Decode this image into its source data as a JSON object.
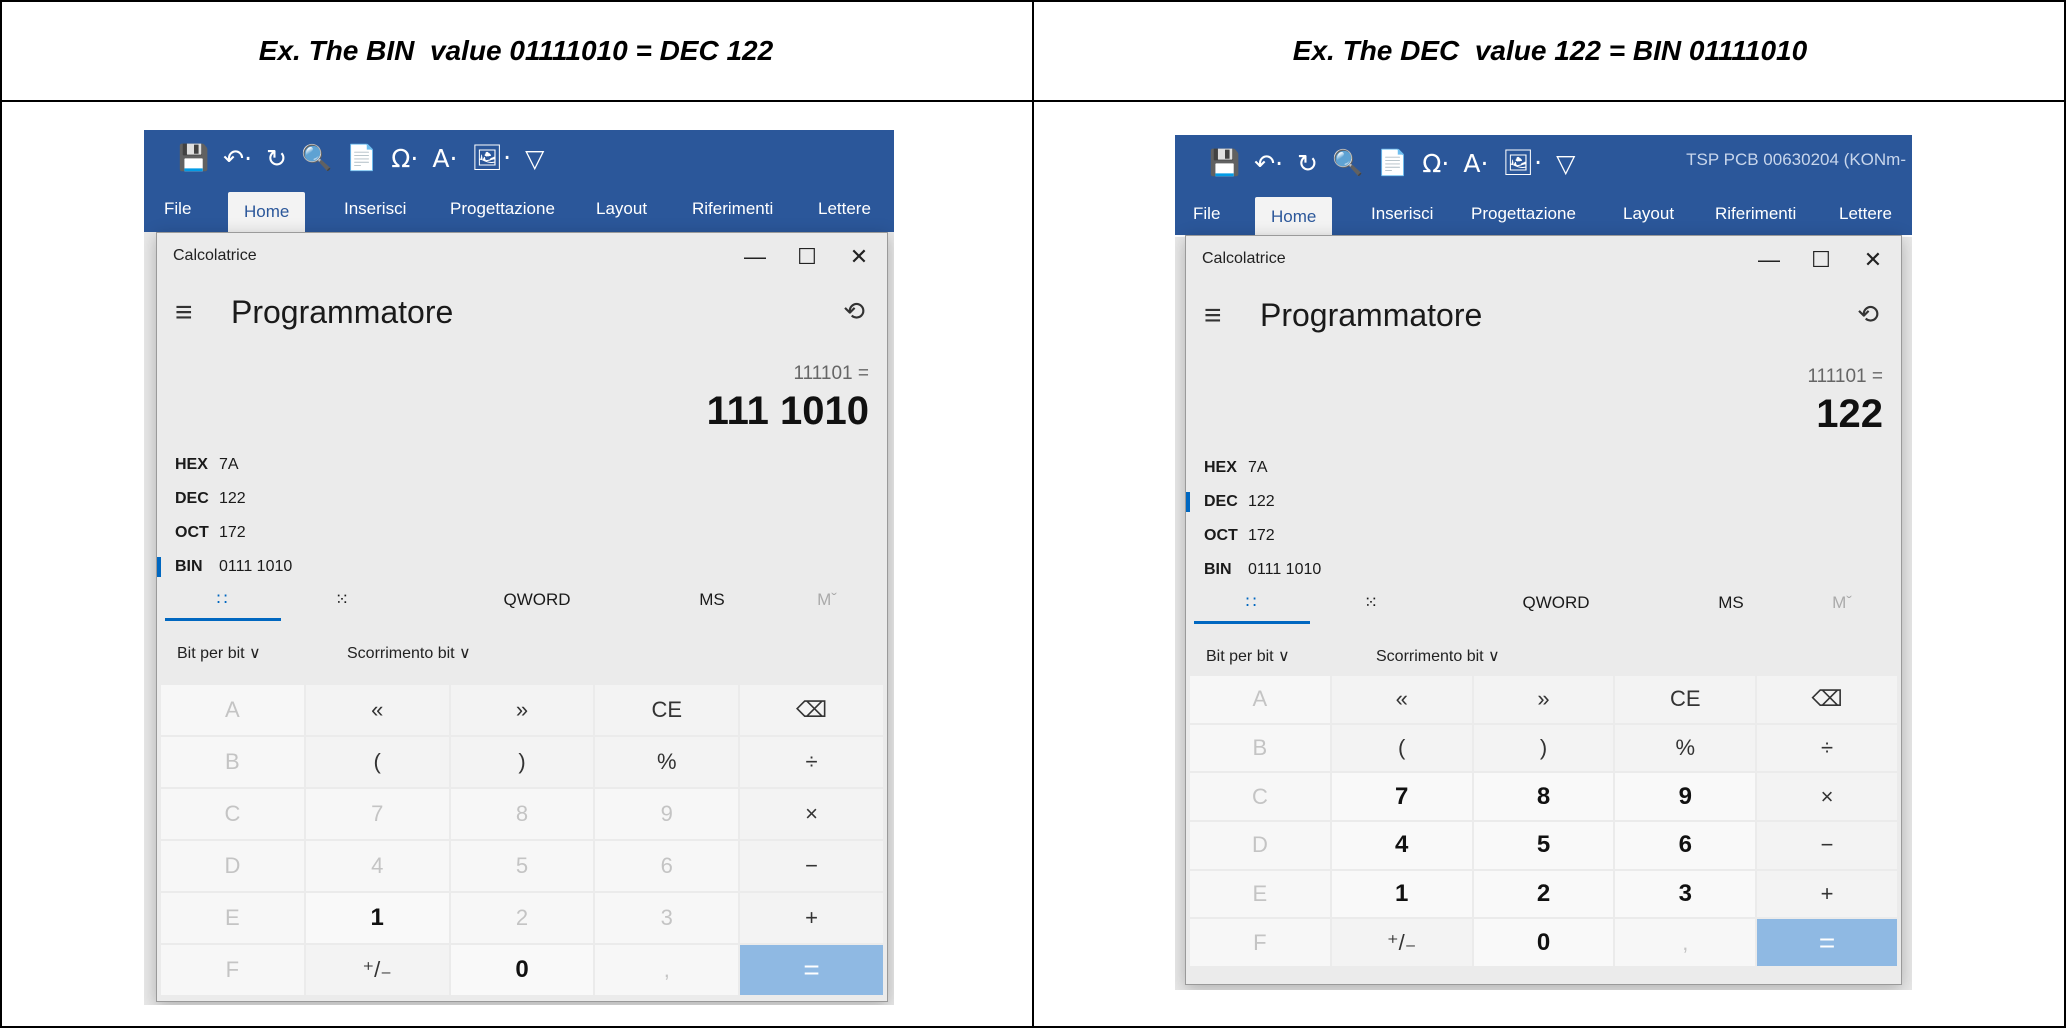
{
  "left": {
    "header": "Ex. The BIN  value 01111010 = DEC 122",
    "word": {
      "qat": [
        "💾",
        "↶·",
        "↻",
        "🔍",
        "📄",
        "Ω·",
        "A·",
        "🖼·",
        "▽"
      ],
      "doc_name": "",
      "tabs": [
        "File",
        "Home",
        "Inserisci",
        "Progettazione",
        "Layout",
        "Riferimenti",
        "Lettere"
      ]
    },
    "calc": {
      "app_name": "Calcolatrice",
      "minimize": "—",
      "maximize": "☐",
      "close": "✕",
      "hamburger": "≡",
      "mode": "Programmatore",
      "history_icon": "⟲",
      "expression": "111101 =",
      "result": "111 1010",
      "radix": [
        {
          "key": "HEX",
          "value": "7A"
        },
        {
          "key": "DEC",
          "value": "122"
        },
        {
          "key": "OCT",
          "value": "172"
        },
        {
          "key": "BIN",
          "value": "0111 1010"
        }
      ],
      "selected_radix": "BIN",
      "keypad_tabs": {
        "full": "∷",
        "bit": "⁙",
        "word": "QWORD",
        "ms": "MS",
        "m": "Mˇ"
      },
      "bitwise": "Bit per bit ∨",
      "bitshift": "Scorrimento bit ∨",
      "keys": [
        "A",
        "«",
        "»",
        "CE",
        "⌫",
        "B",
        "(",
        ")",
        "%",
        "÷",
        "C",
        "7",
        "8",
        "9",
        "×",
        "D",
        "4",
        "5",
        "6",
        "−",
        "E",
        "1",
        "2",
        "3",
        "+",
        "F",
        "⁺/₋",
        "0",
        ",",
        "="
      ]
    }
  },
  "right": {
    "header": "Ex. The DEC  value 122 = BIN 01111010",
    "word": {
      "qat": [
        "💾",
        "↶·",
        "↻",
        "🔍",
        "📄",
        "Ω·",
        "A·",
        "🖼·",
        "▽"
      ],
      "doc_name": "TSP PCB 00630204 (KONm-",
      "tabs": [
        "File",
        "Home",
        "Inserisci",
        "Progettazione",
        "Layout",
        "Riferimenti",
        "Lettere"
      ]
    },
    "calc": {
      "app_name": "Calcolatrice",
      "minimize": "—",
      "maximize": "☐",
      "close": "✕",
      "hamburger": "≡",
      "mode": "Programmatore",
      "history_icon": "⟲",
      "expression": "111101 =",
      "result": "122",
      "radix": [
        {
          "key": "HEX",
          "value": "7A"
        },
        {
          "key": "DEC",
          "value": "122"
        },
        {
          "key": "OCT",
          "value": "172"
        },
        {
          "key": "BIN",
          "value": "0111 1010"
        }
      ],
      "selected_radix": "DEC",
      "keypad_tabs": {
        "full": "∷",
        "bit": "⁙",
        "word": "QWORD",
        "ms": "MS",
        "m": "Mˇ"
      },
      "bitwise": "Bit per bit ∨",
      "bitshift": "Scorrimento bit ∨",
      "keys": [
        "A",
        "«",
        "»",
        "CE",
        "⌫",
        "B",
        "(",
        ")",
        "%",
        "÷",
        "C",
        "7",
        "8",
        "9",
        "×",
        "D",
        "4",
        "5",
        "6",
        "−",
        "E",
        "1",
        "2",
        "3",
        "+",
        "F",
        "⁺/₋",
        "0",
        ",",
        "="
      ]
    }
  }
}
